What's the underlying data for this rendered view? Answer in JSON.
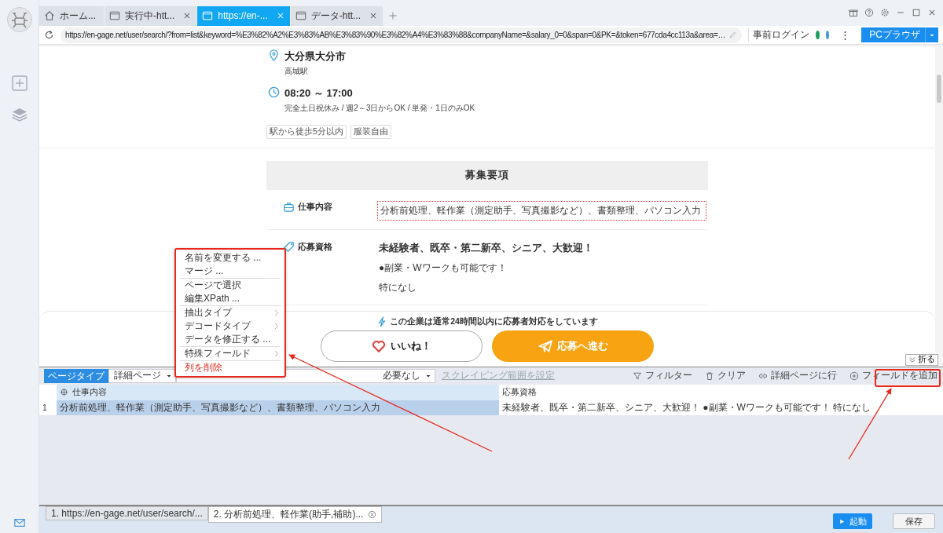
{
  "browser_tabs": [
    {
      "label": "ホーム...",
      "kind": "home",
      "closable": false,
      "selected": false
    },
    {
      "label": "実行中-htt...",
      "kind": "page",
      "closable": true,
      "selected": false
    },
    {
      "label": "https://en-...",
      "kind": "page",
      "closable": true,
      "selected": true
    },
    {
      "label": "データ-htt...",
      "kind": "page",
      "closable": true,
      "selected": false
    }
  ],
  "address_bar": {
    "url": "https://en-gage.net/user/search/?from=list&keyword=%E3%82%A2%E3%83%AB%E3%83%90%E3%82%A4%E3%83%88&companyName=&salary_0=0&span=0&PK=&token=677cda4cc113a&area=…",
    "login_label": "事前ログイン",
    "more_label": "⋮",
    "browser_mode": "PCブラウザ"
  },
  "job": {
    "location": {
      "city": "大分県大分市",
      "station": "高城駅"
    },
    "hours": {
      "time": "08:20 ～ 17:00",
      "note": "完全土日祝休み / 週2～3日からOK / 単発・1日のみOK"
    },
    "tags": [
      "駅から徒歩5分以内",
      "服装自由"
    ],
    "section_title": "募集要項",
    "rows": [
      {
        "label": "仕事内容",
        "highlighted": true,
        "lines": [
          {
            "kind": "plain",
            "text": "分析前処理、軽作業（測定助手、写真撮影など）、書類整理、パソコン入力"
          }
        ]
      },
      {
        "label": "応募資格",
        "highlighted": false,
        "lines": [
          {
            "kind": "heading",
            "text": "未経験者、既卒・第二新卒、シニア、大歓迎！"
          },
          {
            "kind": "plain",
            "text": "●副業・Wワークも可能です！"
          },
          {
            "kind": "plain",
            "text": "特になし"
          }
        ]
      }
    ],
    "response_notice": "この企業は通常24時間以内に応募者対応をしています",
    "like_button": "いいね！",
    "apply_button": "応募へ進む"
  },
  "collapse_button": "折る",
  "toolbar": {
    "page_type_label": "ページタイプ",
    "page_type_value": "詳細ページ",
    "second_select_value": "必要なし",
    "scope_link": "スクレイピング範囲を設定",
    "actions": [
      {
        "label": "フィルター"
      },
      {
        "label": "クリア"
      },
      {
        "label": "詳細ページに行"
      },
      {
        "label": "フィールドを追加"
      }
    ]
  },
  "table": {
    "columns": [
      {
        "label": "仕事内容",
        "selected": true
      },
      {
        "label": "応募資格",
        "selected": false
      }
    ],
    "rows": [
      {
        "index": "1",
        "cells": [
          "分析前処理、軽作業（測定助手、写真撮影など）、書類整理、パソコン入力",
          "未経験者、既卒・第二新卒、シニア、大歓迎！ ●副業・Wワークも可能です！ 特になし"
        ]
      }
    ]
  },
  "context_menu": {
    "groups": [
      [
        {
          "label": "名前を変更する ...",
          "submenu": false,
          "kind": "normal"
        },
        {
          "label": "マージ ...",
          "submenu": false,
          "kind": "normal"
        }
      ],
      [
        {
          "label": "ページで選択",
          "submenu": false,
          "kind": "normal"
        },
        {
          "label": "編集XPath ...",
          "submenu": false,
          "kind": "normal"
        }
      ],
      [
        {
          "label": "抽出タイプ",
          "submenu": true,
          "kind": "normal"
        },
        {
          "label": "デコードタイプ",
          "submenu": true,
          "kind": "normal"
        },
        {
          "label": "データを修正する ...",
          "submenu": false,
          "kind": "normal"
        }
      ],
      [
        {
          "label": "特殊フィールド",
          "submenu": true,
          "kind": "normal"
        }
      ],
      [
        {
          "label": "列を削除",
          "submenu": false,
          "kind": "danger"
        }
      ]
    ]
  },
  "step_tabs": [
    {
      "label": "1. https://en-gage.net/user/search/...",
      "selected": false,
      "closable": false
    },
    {
      "label": "2. 分析前処理、軽作業(助手,補助)...",
      "selected": true,
      "closable": true
    }
  ],
  "footer_buttons": [
    {
      "label": "起動",
      "kind": "primary"
    },
    {
      "label": "保存",
      "kind": "secondary"
    }
  ]
}
